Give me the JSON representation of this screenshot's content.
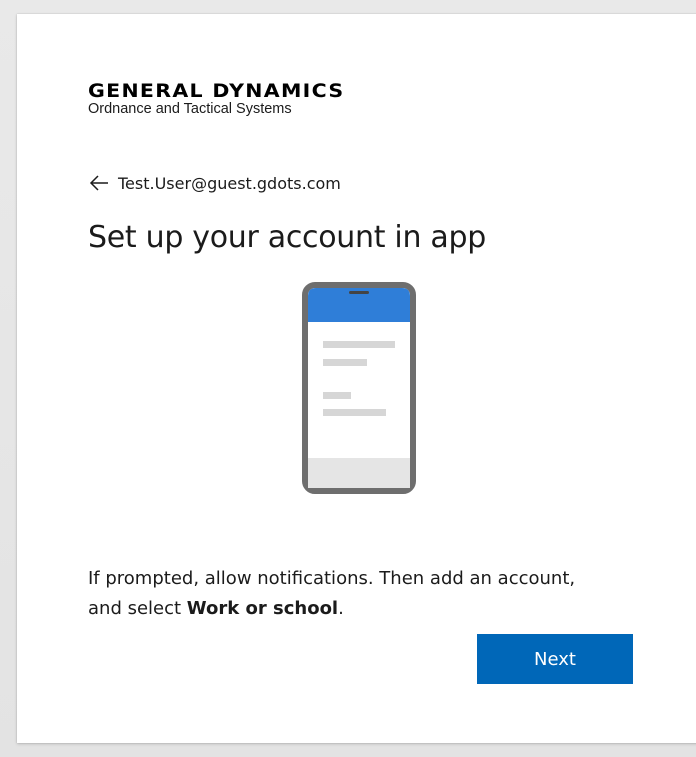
{
  "branding": {
    "company_name": "GENERAL DYNAMICS",
    "division": "Ordnance and Tactical Systems"
  },
  "identity": {
    "back_icon": "arrow-left-icon",
    "email": "Test.User@guest.gdots.com"
  },
  "page": {
    "title": "Set up your account in app"
  },
  "illustration": {
    "icon": "phone-app-icon",
    "accent_color": "#2f7ed8"
  },
  "instructions": {
    "text_before": "If prompted, allow notifications. Then add an account, and select ",
    "emphasis": "Work or school",
    "text_after": "."
  },
  "actions": {
    "next_label": "Next"
  },
  "colors": {
    "button_bg": "#0067b8",
    "button_text": "#ffffff"
  }
}
